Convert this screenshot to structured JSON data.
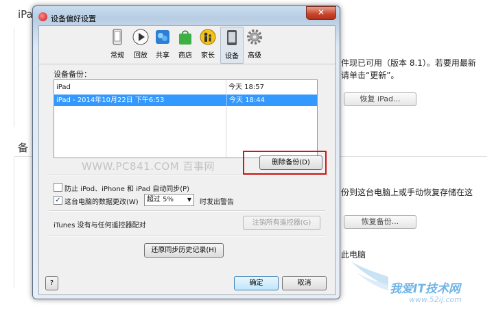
{
  "background": {
    "section1_heading": "iPa",
    "section2_heading": "备",
    "update_line1": "件现已可用（版本 8.1）。若要用最新",
    "update_line2": "请单击“更新”。",
    "restore_ipad_button": "恢复 iPad...",
    "backup_line": "份到这台电脑上或手动恢复存储在这",
    "restore_backup_button": "恢复备份...",
    "computer_text": "此电脑"
  },
  "watermark": {
    "site_logo": "我爱IT技术网",
    "site_url": "www.52ij.com",
    "pc841": "WWW.PC841.COM 百事网"
  },
  "dialog": {
    "title": "设备偏好设置",
    "close_label": "✕",
    "toolbar": [
      {
        "label": "常规",
        "icon": "phone-general-icon"
      },
      {
        "label": "回放",
        "icon": "play-icon"
      },
      {
        "label": "共享",
        "icon": "share-icon"
      },
      {
        "label": "商店",
        "icon": "store-bag-icon"
      },
      {
        "label": "家长",
        "icon": "parental-icon"
      },
      {
        "label": "设备",
        "icon": "device-icon"
      },
      {
        "label": "高级",
        "icon": "gear-icon"
      }
    ],
    "backups_label": "设备备份：",
    "backups": [
      {
        "name": "iPad",
        "date": "今天 18:57",
        "selected": false
      },
      {
        "name": "iPad - 2014年10月22日 下午6:53",
        "date": "今天 18:44",
        "selected": true
      }
    ],
    "delete_backup_button": "删除备份(D)",
    "prevent_sync_label": "防止 iPod、iPhone 和 iPad 自动同步(P)",
    "prevent_sync_checked": false,
    "warn_label": "这台电脑的数据更改(W)",
    "warn_checked": true,
    "warn_select_value": "超过 5%",
    "warn_suffix": "时发出警告",
    "remotes_label": "iTunes 没有与任何遥控器配对",
    "forget_remotes_button": "注销所有遥控器(G)",
    "reset_history_button": "还原同步历史记录(H)",
    "help_button": "?",
    "ok_button": "确定",
    "cancel_button": "取消"
  },
  "colors": {
    "selection": "#3399ff",
    "highlight_box": "#d21414",
    "watermark_blue": "#6fb4e6"
  }
}
